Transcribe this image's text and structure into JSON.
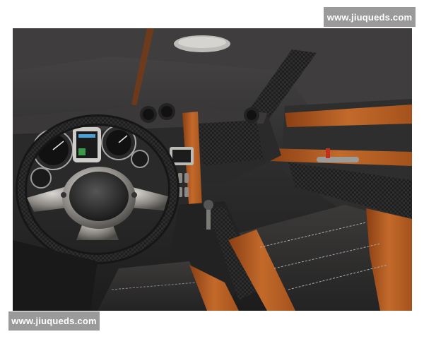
{
  "watermark": {
    "top_text": "www.jiuqueds.com",
    "bottom_text": "www.jiuqueds.com"
  },
  "photo": {
    "subject": "car interior dashboard and seats",
    "colors": {
      "dark": "#2a2929",
      "charcoal": "#3a3838",
      "leather_orange": "#b65a21",
      "metal": "#8d8a86",
      "light_gray": "#b8b6b3",
      "watermark_bg": "#9a9a9a"
    }
  }
}
